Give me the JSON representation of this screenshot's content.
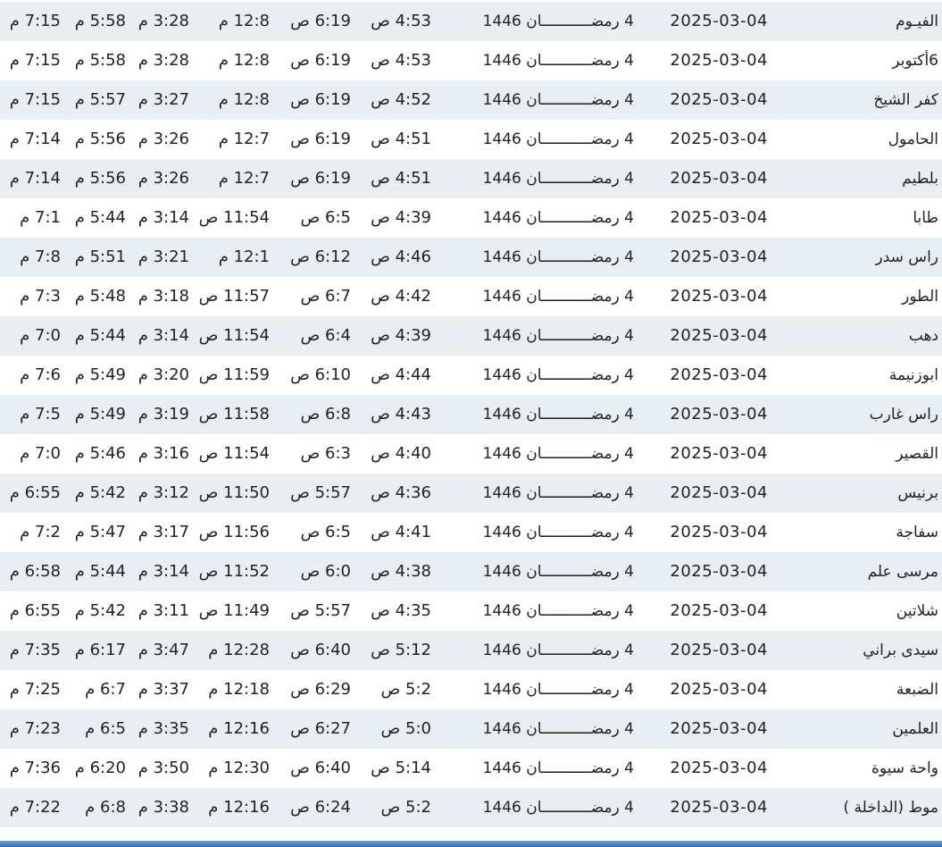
{
  "colors": {
    "row_alt_bg": "#e9eef2",
    "row_bg": "#ffffff",
    "text": "#222222",
    "bottom_strip": "#2f6db3"
  },
  "rows": [
    {
      "city": "الفيـوم",
      "date": "2025-03-04",
      "hijri": "4 رمضـــــــــــان 1446",
      "fajr": "4:53 ص",
      "sunrise": "6:19 ص",
      "dhuhr": "12:8 م",
      "asr": "3:28 م",
      "maghrib": "5:58 م",
      "isha": "7:15 م"
    },
    {
      "city": "6أكتوبر",
      "date": "2025-03-04",
      "hijri": "4 رمضـــــــــــان 1446",
      "fajr": "4:53 ص",
      "sunrise": "6:19 ص",
      "dhuhr": "12:8 م",
      "asr": "3:28 م",
      "maghrib": "5:58 م",
      "isha": "7:15 م"
    },
    {
      "city": "كفر الشيخ",
      "date": "2025-03-04",
      "hijri": "4 رمضـــــــــــان 1446",
      "fajr": "4:52 ص",
      "sunrise": "6:19 ص",
      "dhuhr": "12:8 م",
      "asr": "3:27 م",
      "maghrib": "5:57 م",
      "isha": "7:15 م"
    },
    {
      "city": "الحامول",
      "date": "2025-03-04",
      "hijri": "4 رمضـــــــــــان 1446",
      "fajr": "4:51 ص",
      "sunrise": "6:19 ص",
      "dhuhr": "12:7 م",
      "asr": "3:26 م",
      "maghrib": "5:56 م",
      "isha": "7:14 م"
    },
    {
      "city": "بلطيم",
      "date": "2025-03-04",
      "hijri": "4 رمضـــــــــــان 1446",
      "fajr": "4:51 ص",
      "sunrise": "6:19 ص",
      "dhuhr": "12:7 م",
      "asr": "3:26 م",
      "maghrib": "5:56 م",
      "isha": "7:14 م"
    },
    {
      "city": "طابا",
      "date": "2025-03-04",
      "hijri": "4 رمضـــــــــــان 1446",
      "fajr": "4:39 ص",
      "sunrise": "6:5 ص",
      "dhuhr": "11:54 ص",
      "asr": "3:14 م",
      "maghrib": "5:44 م",
      "isha": "7:1 م"
    },
    {
      "city": "راس سدر",
      "date": "2025-03-04",
      "hijri": "4 رمضـــــــــــان 1446",
      "fajr": "4:46 ص",
      "sunrise": "6:12 ص",
      "dhuhr": "12:1 م",
      "asr": "3:21 م",
      "maghrib": "5:51 م",
      "isha": "7:8 م"
    },
    {
      "city": "الطور",
      "date": "2025-03-04",
      "hijri": "4 رمضـــــــــــان 1446",
      "fajr": "4:42 ص",
      "sunrise": "6:7 ص",
      "dhuhr": "11:57 ص",
      "asr": "3:18 م",
      "maghrib": "5:48 م",
      "isha": "7:3 م"
    },
    {
      "city": "دهب",
      "date": "2025-03-04",
      "hijri": "4 رمضـــــــــــان 1446",
      "fajr": "4:39 ص",
      "sunrise": "6:4 ص",
      "dhuhr": "11:54 ص",
      "asr": "3:14 م",
      "maghrib": "5:44 م",
      "isha": "7:0 م"
    },
    {
      "city": "ابوزنيمة",
      "date": "2025-03-04",
      "hijri": "4 رمضـــــــــــان 1446",
      "fajr": "4:44 ص",
      "sunrise": "6:10 ص",
      "dhuhr": "11:59 ص",
      "asr": "3:20 م",
      "maghrib": "5:49 م",
      "isha": "7:6 م"
    },
    {
      "city": "راس غارب",
      "date": "2025-03-04",
      "hijri": "4 رمضـــــــــــان 1446",
      "fajr": "4:43 ص",
      "sunrise": "6:8 ص",
      "dhuhr": "11:58 ص",
      "asr": "3:19 م",
      "maghrib": "5:49 م",
      "isha": "7:5 م"
    },
    {
      "city": "القصير",
      "date": "2025-03-04",
      "hijri": "4 رمضـــــــــــان 1446",
      "fajr": "4:40 ص",
      "sunrise": "6:3 ص",
      "dhuhr": "11:54 ص",
      "asr": "3:16 م",
      "maghrib": "5:46 م",
      "isha": "7:0 م"
    },
    {
      "city": "برنيس",
      "date": "2025-03-04",
      "hijri": "4 رمضـــــــــــان 1446",
      "fajr": "4:36 ص",
      "sunrise": "5:57 ص",
      "dhuhr": "11:50 ص",
      "asr": "3:12 م",
      "maghrib": "5:42 م",
      "isha": "6:55 م"
    },
    {
      "city": "سفاجة",
      "date": "2025-03-04",
      "hijri": "4 رمضـــــــــــان 1446",
      "fajr": "4:41 ص",
      "sunrise": "6:5 ص",
      "dhuhr": "11:56 ص",
      "asr": "3:17 م",
      "maghrib": "5:47 م",
      "isha": "7:2 م"
    },
    {
      "city": "مرسى علم",
      "date": "2025-03-04",
      "hijri": "4 رمضـــــــــــان 1446",
      "fajr": "4:38 ص",
      "sunrise": "6:0 ص",
      "dhuhr": "11:52 ص",
      "asr": "3:14 م",
      "maghrib": "5:44 م",
      "isha": "6:58 م"
    },
    {
      "city": "شلاتين",
      "date": "2025-03-04",
      "hijri": "4 رمضـــــــــــان 1446",
      "fajr": "4:35 ص",
      "sunrise": "5:57 ص",
      "dhuhr": "11:49 ص",
      "asr": "3:11 م",
      "maghrib": "5:42 م",
      "isha": "6:55 م"
    },
    {
      "city": "سيدى براني",
      "date": "2025-03-04",
      "hijri": "4 رمضـــــــــــان 1446",
      "fajr": "5:12 ص",
      "sunrise": "6:40 ص",
      "dhuhr": "12:28 م",
      "asr": "3:47 م",
      "maghrib": "6:17 م",
      "isha": "7:35 م"
    },
    {
      "city": "الضبعة",
      "date": "2025-03-04",
      "hijri": "4 رمضـــــــــــان 1446",
      "fajr": "5:2 ص",
      "sunrise": "6:29 ص",
      "dhuhr": "12:18 م",
      "asr": "3:37 م",
      "maghrib": "6:7 م",
      "isha": "7:25 م"
    },
    {
      "city": "العلمين",
      "date": "2025-03-04",
      "hijri": "4 رمضـــــــــــان 1446",
      "fajr": "5:0 ص",
      "sunrise": "6:27 ص",
      "dhuhr": "12:16 م",
      "asr": "3:35 م",
      "maghrib": "6:5 م",
      "isha": "7:23 م"
    },
    {
      "city": "واحة سيوة",
      "date": "2025-03-04",
      "hijri": "4 رمضـــــــــــان 1446",
      "fajr": "5:14 ص",
      "sunrise": "6:40 ص",
      "dhuhr": "12:30 م",
      "asr": "3:50 م",
      "maghrib": "6:20 م",
      "isha": "7:36 م"
    },
    {
      "city": "موط (الداخلة )",
      "date": "2025-03-04",
      "hijri": "4 رمضـــــــــــان 1446",
      "fajr": "5:2 ص",
      "sunrise": "6:24 ص",
      "dhuhr": "12:16 م",
      "asr": "3:38 م",
      "maghrib": "6:8 م",
      "isha": "7:22 م"
    }
  ]
}
